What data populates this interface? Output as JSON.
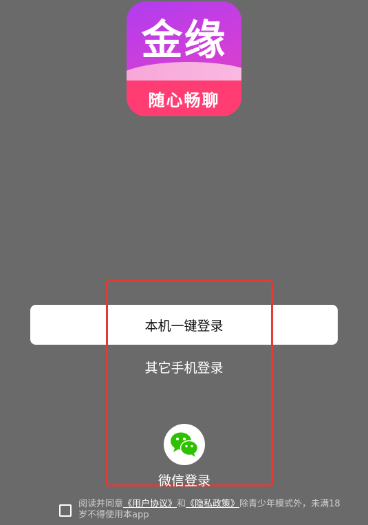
{
  "logo": {
    "brand": "金缘",
    "slogan": "随心畅聊"
  },
  "login": {
    "one_click": "本机一键登录",
    "other_phone": "其它手机登录",
    "wechat": "微信登录"
  },
  "agreement": {
    "prefix": "阅读并同意",
    "user_agreement": "《用户协议》",
    "and": "和",
    "privacy_policy": "《隐私政策》",
    "suffix": "除青少年模式外，未满18岁不得使用本app"
  },
  "colors": {
    "background": "#6a6a6a",
    "highlight_border": "#e53935",
    "wechat_green": "#2dc100"
  }
}
